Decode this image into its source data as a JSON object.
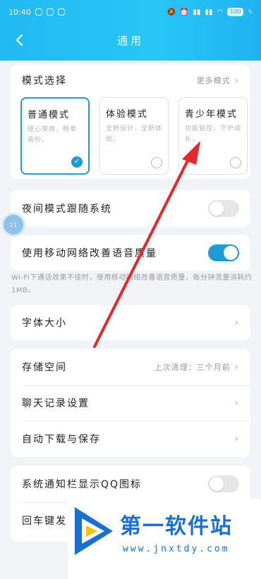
{
  "status_bar": {
    "time": "10:40",
    "battery": "100"
  },
  "header": {
    "title": "通用"
  },
  "mode_section": {
    "title": "模式选择",
    "more_label": "更多模式",
    "modes": [
      {
        "name": "普通模式",
        "desc": "随心使用，畅享装扮。",
        "selected": true
      },
      {
        "name": "体验模式",
        "desc": "全新设计，全新体验。",
        "selected": false
      },
      {
        "name": "青少年模式",
        "desc": "功能管控，守护成长。",
        "selected": false
      }
    ]
  },
  "settings": {
    "night_follow": {
      "label": "夜间模式跟随系统",
      "on": false
    },
    "mobile_voice": {
      "label": "使用移动网络改善语音质量",
      "on": true
    },
    "mobile_voice_note": "Wi-Fi下通话效果不佳时，使用移动网络改善语音质量，每分钟流量消耗约1MB。",
    "font_size": {
      "label": "字体大小"
    },
    "storage": {
      "label": "存储空间",
      "value": "上次清理：三个月前"
    },
    "chat_record": {
      "label": "聊天记录设置"
    },
    "auto_download": {
      "label": "自动下载与保存"
    },
    "qq_icon_notify": {
      "label": "系统通知栏显示QQ图标",
      "on": false
    },
    "enter_send": {
      "label": "回车键发"
    }
  },
  "float_bubble": {
    "text": "11"
  },
  "watermark": {
    "title": "第一软件站",
    "url": "www.jnxtdy.com"
  },
  "colors": {
    "header_start": "#22b9f3",
    "accent": "#1f9bd8",
    "arrow": "#e8262d",
    "watermark": "#1a6fd2"
  }
}
